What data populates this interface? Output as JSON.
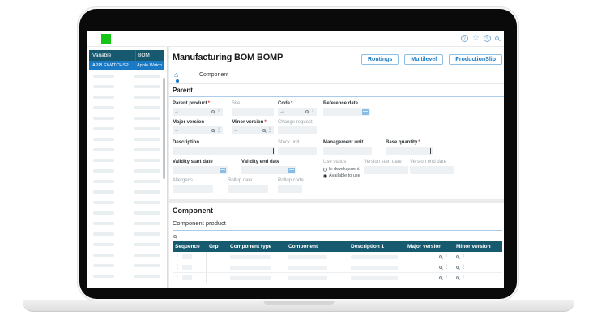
{
  "icons": {
    "help": "?",
    "star": "☆",
    "compose": "✎",
    "home": "⌂",
    "arrow": "→",
    "dots": "⋮"
  },
  "sidebar": {
    "columns": [
      "Variable",
      "BOM"
    ],
    "selected_row": {
      "variable": "APPLEWATCHSP",
      "bom": "Apple Watch..."
    },
    "placeholder_row_count": 20
  },
  "header": {
    "title": "Manufacturing BOM BOMP",
    "buttons": [
      {
        "label": "Routings"
      },
      {
        "label": "Multilevel"
      },
      {
        "label": "ProductionSlip"
      }
    ]
  },
  "tabs": {
    "component": "Component"
  },
  "parent": {
    "section_title": "Parent",
    "required_marker": "*",
    "fields": {
      "parent_product": {
        "label": "Parent product",
        "required": true
      },
      "site": {
        "label": "Site"
      },
      "code": {
        "label": "Code",
        "required": true
      },
      "reference_date": {
        "label": "Reference date"
      },
      "major_version": {
        "label": "Major version"
      },
      "minor_version": {
        "label": "Minor version",
        "required": true
      },
      "change_request": {
        "label": "Change request"
      },
      "description": {
        "label": "Description"
      },
      "stock_unit": {
        "label": "Stock unit"
      },
      "management_unit": {
        "label": "Management unit"
      },
      "base_quantity": {
        "label": "Base quantity",
        "required": true
      },
      "validity_start_date": {
        "label": "Validity start date"
      },
      "validity_end_date": {
        "label": "Validity end date"
      },
      "use_status": {
        "label": "Use status",
        "options": [
          {
            "label": "In development",
            "selected": false
          },
          {
            "label": "Available to use",
            "selected": true
          }
        ]
      },
      "version_start_date": {
        "label": "Version start date"
      },
      "version_end_date": {
        "label": "Version end date"
      },
      "allergens": {
        "label": "Allergens"
      },
      "rollup_date": {
        "label": "Rollup date"
      },
      "rollup_code": {
        "label": "Rollup code"
      }
    }
  },
  "component": {
    "section_title": "Component",
    "subtitle": "Component product",
    "columns": [
      "Sequence",
      "Grp",
      "Component type",
      "Component",
      "Description 1",
      "Major version",
      "Minor version"
    ],
    "row_count": 3
  },
  "colors": {
    "accent_blue": "#1879c6",
    "teal_header": "#175a70",
    "selected_row_blue": "#1a7ac5",
    "logo_green": "#17c517"
  }
}
